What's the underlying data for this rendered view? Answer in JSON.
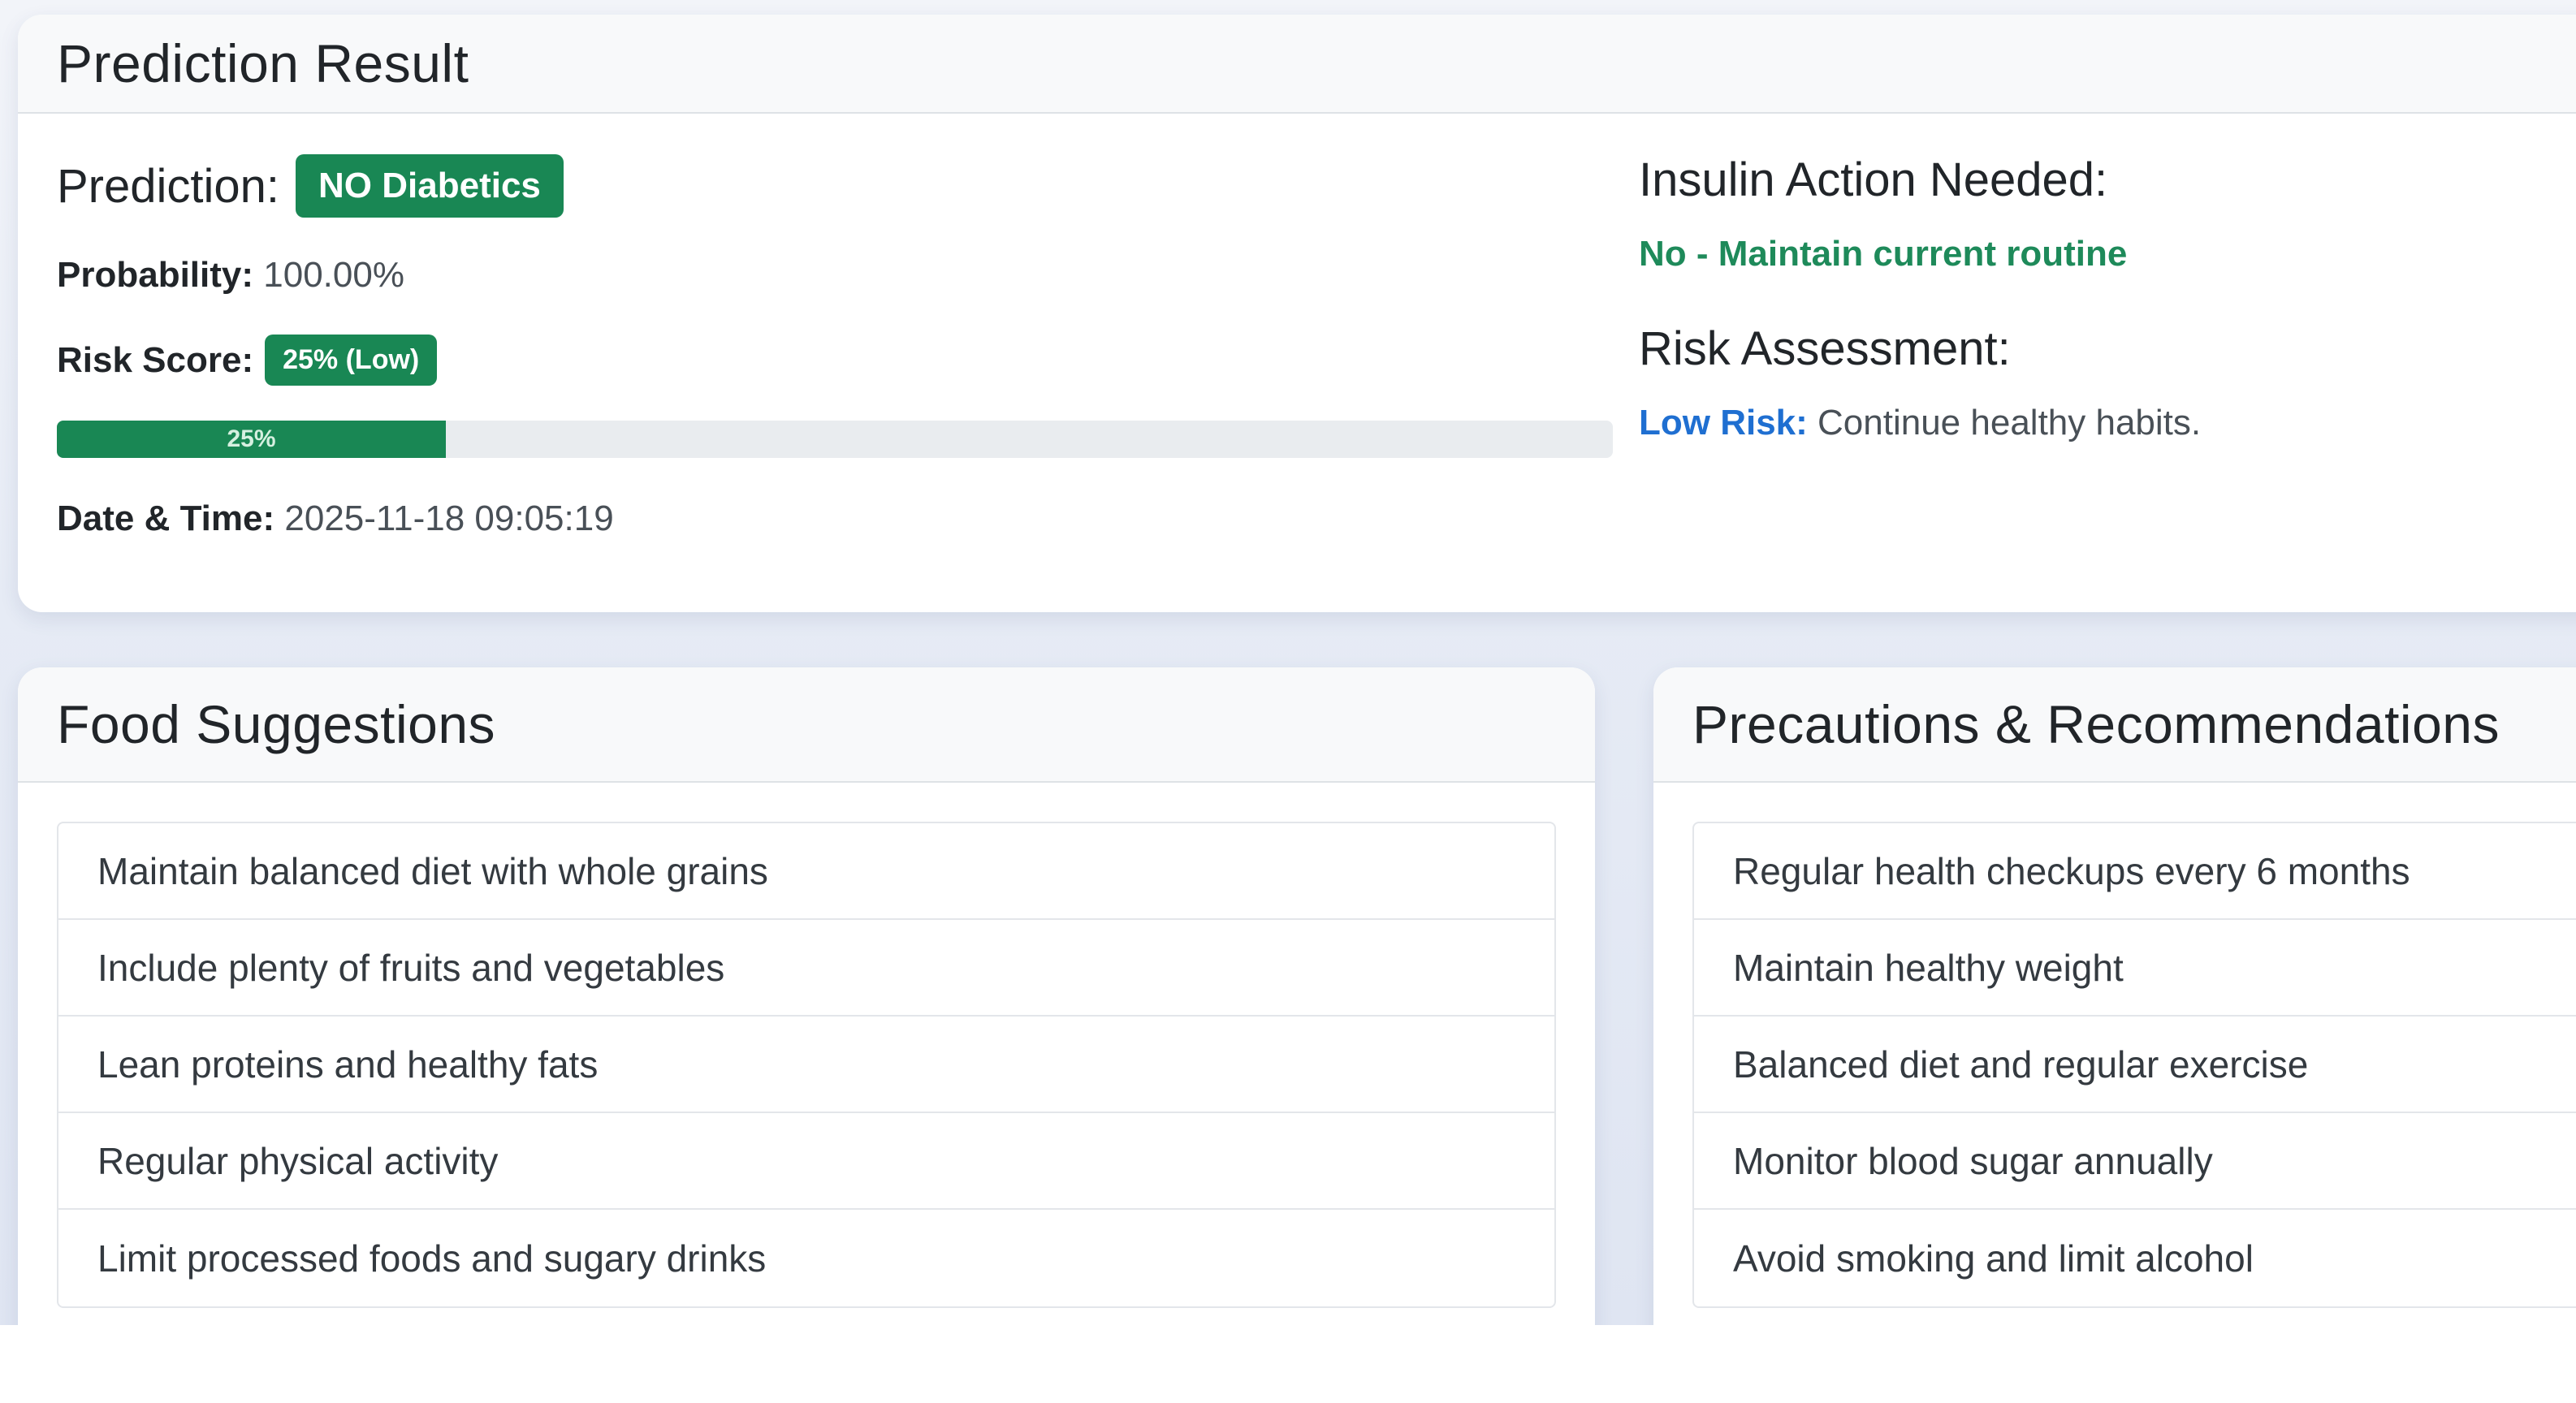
{
  "result": {
    "title": "Prediction Result",
    "prediction_label": "Prediction:",
    "prediction_badge": "NO Diabetics",
    "probability_label": "Probability:",
    "probability_value": "100.00%",
    "risk_score_label": "Risk Score:",
    "risk_score_badge": "25% (Low)",
    "progress": {
      "value": 0.25,
      "label": "25%"
    },
    "datetime_label": "Date & Time:",
    "datetime_value": "2025-11-18 09:05:19",
    "insulin_heading": "Insulin Action Needed:",
    "insulin_value": "No - Maintain current routine",
    "risk_heading": "Risk Assessment:",
    "risk_level": "Low Risk:",
    "risk_text": " Continue healthy habits.",
    "colors": {
      "success": "#198754",
      "insulin_text": "#1e8a5a",
      "risk_link": "#1f6fd1"
    }
  },
  "food": {
    "title": "Food Suggestions",
    "items": [
      "Maintain balanced diet with whole grains",
      "Include plenty of fruits and vegetables",
      "Lean proteins and healthy fats",
      "Regular physical activity",
      "Limit processed foods and sugary drinks"
    ]
  },
  "precautions": {
    "title": "Precautions & Recommendations",
    "items": [
      "Regular health checkups every 6 months",
      "Maintain healthy weight",
      "Balanced diet and regular exercise",
      "Monitor blood sugar annually",
      "Avoid smoking and limit alcohol"
    ]
  }
}
